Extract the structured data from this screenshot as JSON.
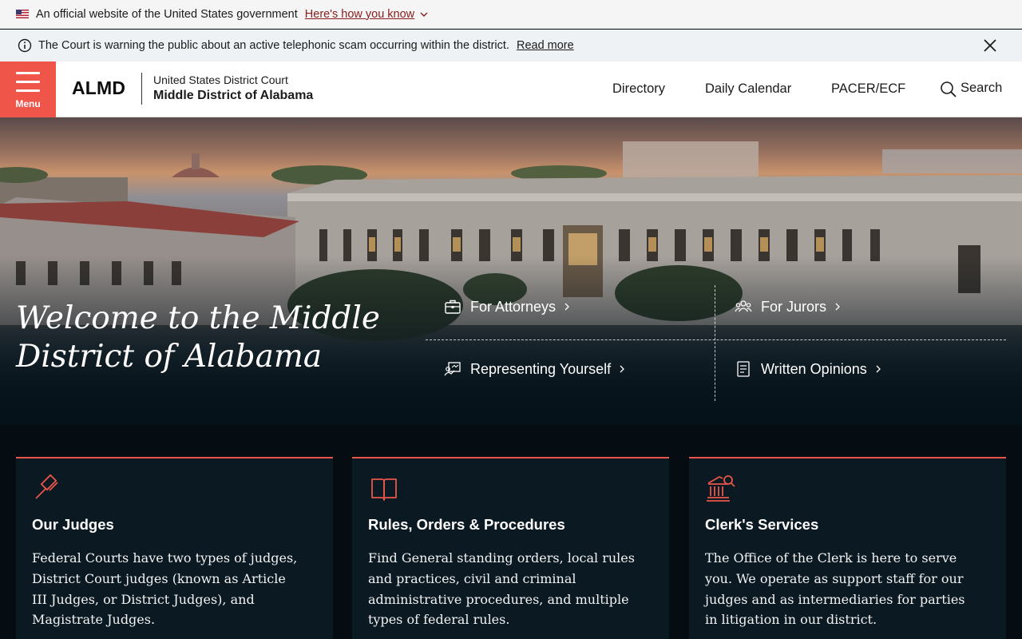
{
  "gov_banner": {
    "text": "An official website of the United States government",
    "link": "Here's how you know"
  },
  "alert": {
    "text": "The Court is warning the public about an active telephonic scam occurring within the district.",
    "link": "Read more"
  },
  "header": {
    "menu_label": "Menu",
    "logo": "ALMD",
    "court_line1": "United States District Court",
    "court_line2": "Middle District of Alabama",
    "nav": [
      "Directory",
      "Daily Calendar",
      "PACER/ECF"
    ],
    "search_label": "Search"
  },
  "hero": {
    "title": "Welcome to the Middle District of Alabama",
    "links": [
      {
        "label": "For Attorneys",
        "icon": "briefcase-icon"
      },
      {
        "label": "For Jurors",
        "icon": "people-icon"
      },
      {
        "label": "Representing Yourself",
        "icon": "presenter-icon"
      },
      {
        "label": "Written Opinions",
        "icon": "document-icon"
      }
    ]
  },
  "cards": [
    {
      "title": "Our Judges",
      "icon": "gavel-icon",
      "text": "Federal Courts have two types of judges, District Court judges (known as Article III Judges, or District Judges), and Magistrate Judges."
    },
    {
      "title": "Rules, Orders & Procedures",
      "icon": "open-book-icon",
      "text": "Find General standing orders, local rules and practices, civil and criminal administrative procedures, and multiple types of federal rules."
    },
    {
      "title": "Clerk's Services",
      "icon": "courthouse-search-icon",
      "text": "The Office of the Clerk is here to serve you. We operate as support staff for our judges and as intermediaries for parties in litigation in our district."
    }
  ],
  "colors": {
    "accent": "#f0554a",
    "card_border": "#e8564a",
    "dark_bg": "#050d12",
    "card_bg": "#0b1922",
    "gov_link": "#8a1c1c"
  }
}
